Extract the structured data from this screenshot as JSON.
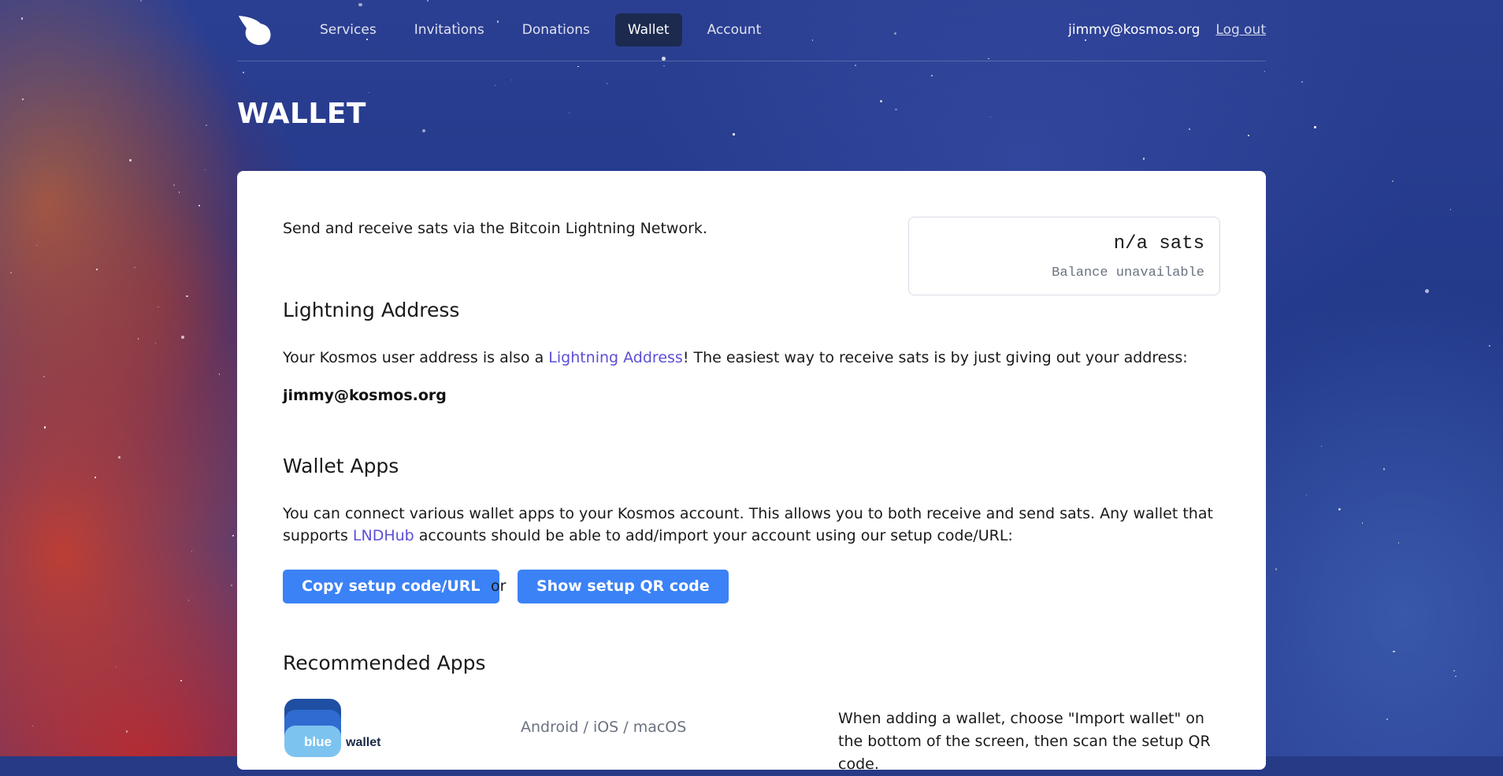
{
  "header": {
    "nav": [
      "Services",
      "Invitations",
      "Donations",
      "Wallet",
      "Account"
    ],
    "active_nav": "Wallet",
    "user_email": "jimmy@kosmos.org",
    "logout_label": "Log out"
  },
  "page_title": "WALLET",
  "intro": "Send and receive sats via the Bitcoin Lightning Network.",
  "balance": {
    "amount": "n/a sats",
    "status": "Balance unavailable"
  },
  "lightning": {
    "heading": "Lightning Address",
    "text_before": "Your Kosmos user address is also a ",
    "link": "Lightning Address",
    "text_after": "! The easiest way to receive sats is by just giving out your address:",
    "address": "jimmy@kosmos.org"
  },
  "wallet_apps": {
    "heading": "Wallet Apps",
    "text_before": "You can connect various wallet apps to your Kosmos account. This allows you to both receive and send sats. Any wallet that supports ",
    "link": "LNDHub",
    "text_after": " accounts should be able to add/import your account using our setup code/URL:",
    "copy_button": "Copy setup code/URL",
    "or": "or",
    "qr_button": "Show setup QR code"
  },
  "recommended": {
    "heading": "Recommended Apps",
    "apps": [
      {
        "logo_text_1": "blue",
        "logo_text_2": "wallet",
        "platforms": "Android / iOS / macOS",
        "instructions": "When adding a wallet, choose \"Import wallet\" on the bottom of the screen, then scan the setup QR code."
      }
    ]
  },
  "colors": {
    "accent": "#3b82f6",
    "link": "#5b4fd6",
    "nav_active_bg": "#1c2a4f"
  }
}
